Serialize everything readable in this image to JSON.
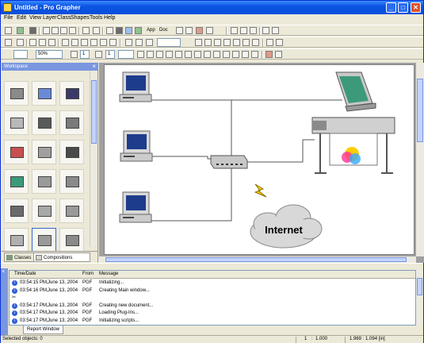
{
  "window": {
    "title": "Untitled - Pro Grapher"
  },
  "menu": [
    "File",
    "Edit",
    "View",
    "Layer",
    "Class",
    "Shapes",
    "Tools",
    "Help"
  ],
  "toolbar": {
    "app_label": "App",
    "doc_label": "Doc",
    "zoom_value": "50%",
    "line_width": "1",
    "line_width2": "1"
  },
  "workspace": {
    "title": "Workspace",
    "tabs": [
      "Classes",
      "Compositions"
    ],
    "items": [
      "workstation-pc",
      "desktop-pc",
      "laptop",
      "pda",
      "tower-server",
      "server-rack",
      "mainframe",
      "printer",
      "large-format-plotter",
      "flatbed-scanner",
      "network-hub",
      "fax-machine",
      "inkjet-printer",
      "router",
      "modem",
      "cd-drive",
      "external-drive",
      "tape-drive"
    ]
  },
  "diagram": {
    "label": "Internet",
    "nodes": [
      "pc-top",
      "pc-middle",
      "pc-bottom",
      "network-hub",
      "flatbed-scanner",
      "large-format-plotter",
      "internet-cloud",
      "lightning-bolt"
    ]
  },
  "report": {
    "tab": "Report Window",
    "columns": [
      "Time/Date",
      "From",
      "Message"
    ],
    "rows": [
      {
        "time": "03:54:15 PM,",
        "date": "June 13, 2004",
        "from": "PGF",
        "msg": "Initializing...",
        "icon": "info"
      },
      {
        "time": "03:54:16 PM,",
        "date": "June 13, 2004",
        "from": "PGF",
        "msg": "Creating Main window...",
        "icon": "info"
      },
      {
        "time": "",
        "date": "",
        "from": "",
        "msg": "",
        "icon": "scissors"
      },
      {
        "time": "03:54:17 PM,",
        "date": "June 13, 2004",
        "from": "PGF",
        "msg": "Creating new document...",
        "icon": "info"
      },
      {
        "time": "03:54:17 PM,",
        "date": "June 13, 2004",
        "from": "PGF",
        "msg": "Loading Plug-Ins...",
        "icon": "info"
      },
      {
        "time": "03:54:17 PM,",
        "date": "June 13, 2004",
        "from": "PGF",
        "msg": "Initializing scripts...",
        "icon": "info"
      }
    ]
  },
  "status": {
    "left": "Selected objects: 0",
    "scale_a": "1",
    "scale_sep": ":",
    "scale_b": "1.000",
    "coords": "1.969 : 1.094 [in]"
  }
}
